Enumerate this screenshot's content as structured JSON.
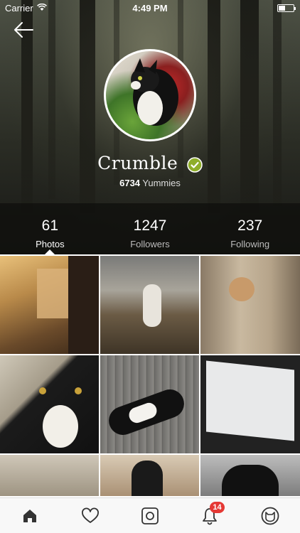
{
  "status_bar": {
    "carrier": "Carrier",
    "time": "4:49 PM"
  },
  "profile": {
    "name": "Crumble",
    "yummies_count": "6734",
    "yummies_label": "Yummies"
  },
  "stats": [
    {
      "value": "61",
      "label": "Photos",
      "active": true
    },
    {
      "value": "1247",
      "label": "Followers",
      "active": false
    },
    {
      "value": "237",
      "label": "Following",
      "active": false
    }
  ],
  "tabbar": {
    "items": [
      "home-icon",
      "heart-icon",
      "camera-icon",
      "bell-icon",
      "cat-face-icon"
    ],
    "notification_badge": "14"
  },
  "colors": {
    "accent_green": "#8fae2a",
    "badge_red": "#e53935",
    "tab_icon": "#333333"
  }
}
